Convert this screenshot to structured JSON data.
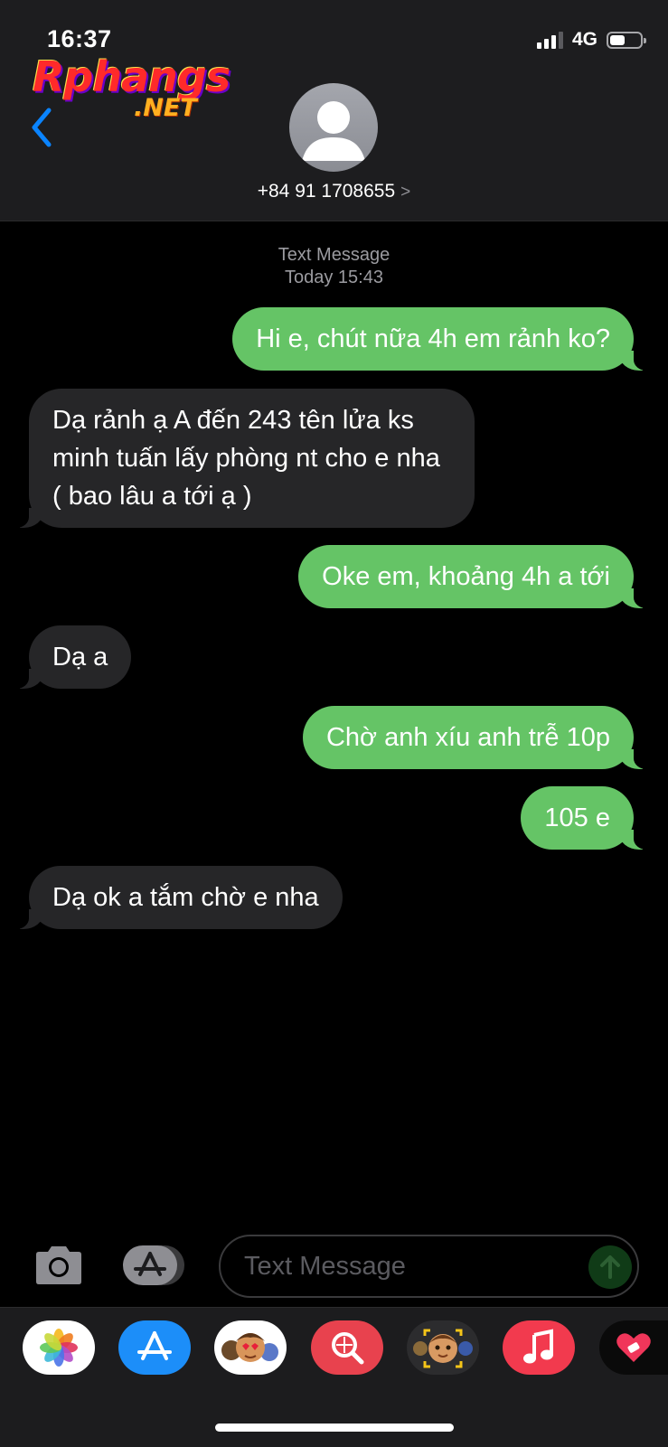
{
  "status_bar": {
    "time": "16:37",
    "network": "4G",
    "signal_bars": 3,
    "battery_level": 0.45
  },
  "watermark": {
    "brand": "Rphangs",
    "suffix": ".NET"
  },
  "header": {
    "contact": "+84 91 1708655",
    "chevron": ">"
  },
  "conversation": {
    "type_label": "Text Message",
    "timestamp": "Today 15:43",
    "messages": [
      {
        "side": "sent",
        "text": "Hi e, chút nữa 4h em rảnh ko?"
      },
      {
        "side": "received",
        "text": "Dạ rảnh ạ A đến 243 tên lửa ks minh tuấn lấy phòng nt cho e nha ( bao lâu a tới ạ )"
      },
      {
        "side": "sent",
        "text": "Oke em, khoảng 4h a tới"
      },
      {
        "side": "received",
        "text": "Dạ a"
      },
      {
        "side": "sent",
        "text": "Chờ anh xíu anh trễ 10p"
      },
      {
        "side": "sent",
        "text": "105 e"
      },
      {
        "side": "received",
        "text": "Dạ ok a tắm chờ e nha"
      }
    ]
  },
  "input_bar": {
    "placeholder": "Text Message"
  },
  "app_drawer": {
    "apps": [
      "photos-icon",
      "app-store-icon",
      "memoji-stickers-icon",
      "search-images-icon",
      "animoji-icon",
      "music-icon",
      "digital-touch-icon"
    ]
  },
  "colors": {
    "sent_bubble": "#65c466",
    "received_bubble": "#262628",
    "accent_blue": "#0a84ff"
  }
}
